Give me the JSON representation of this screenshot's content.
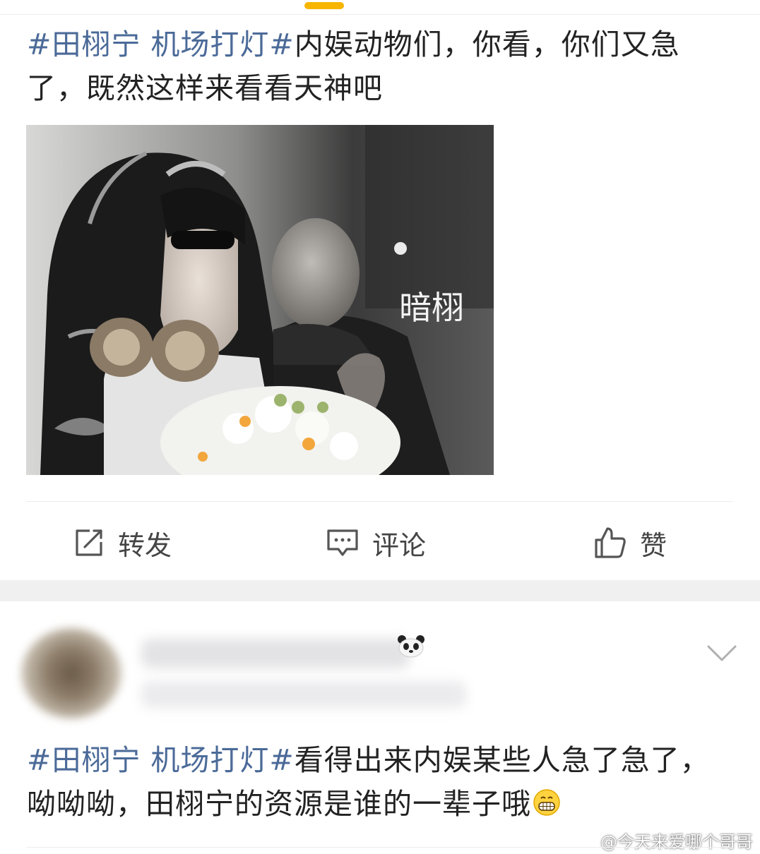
{
  "colors": {
    "hashtag": "#4b6a98",
    "text": "#222222",
    "action": "#444444",
    "scroll_indicator": "#f7b500",
    "feed_gap": "#f0f0f0"
  },
  "post1": {
    "hashtag": "#田栩宁 机场打灯#",
    "text": "内娱动物们，你看，你们又急了，既然这样来看看天神吧",
    "image": {
      "overlay_text": "暗栩"
    }
  },
  "actions": {
    "repost": {
      "icon": "share-edit-icon",
      "label": "转发"
    },
    "comment": {
      "icon": "comment-icon",
      "label": "评论"
    },
    "like": {
      "icon": "thumbs-up-icon",
      "label": "赞"
    }
  },
  "post2": {
    "hashtag": "#田栩宁 机场打灯#",
    "text": "看得出来内娱某些人急了急了，呦呦呦，田栩宁的资源是谁的一辈子哦",
    "emoji": "grin-emoji"
  },
  "watermark": {
    "text": "@今天来爱哪个哥哥",
    "icon": "weibo-logo"
  }
}
